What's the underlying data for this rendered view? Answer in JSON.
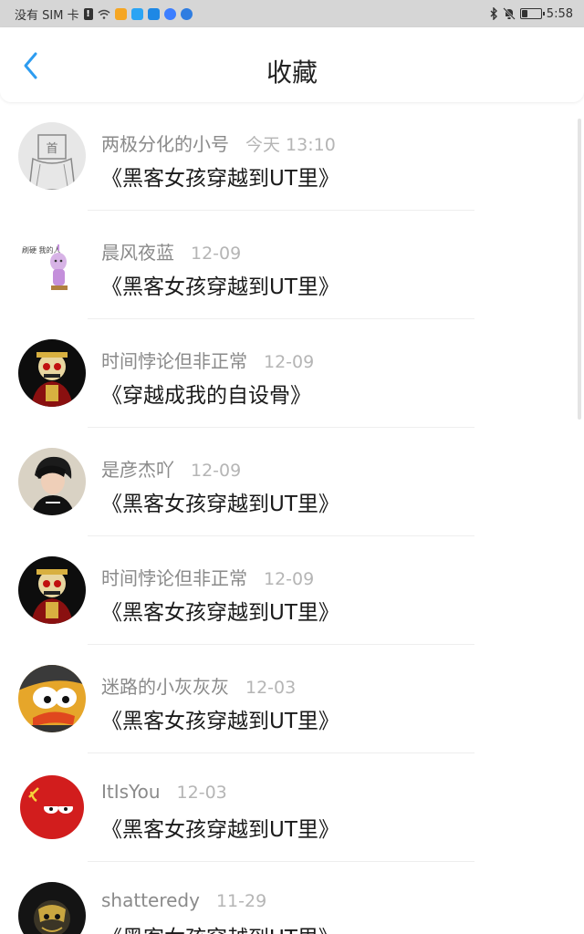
{
  "status_bar": {
    "carrier": "没有 SIM 卡",
    "sim_warning": "!",
    "time": "5:58",
    "battery_level": 0.3,
    "app_icons": [
      {
        "name": "game-app-icon",
        "color": "#f5a623"
      },
      {
        "name": "qq-app-icon",
        "color": "#2aa4f4"
      },
      {
        "name": "qq-alt-app-icon",
        "color": "#1e88e5"
      },
      {
        "name": "music-app-icon",
        "color": "#3d7eff"
      },
      {
        "name": "browser-app-icon",
        "color": "#2f7de1"
      }
    ]
  },
  "header": {
    "title": "收藏",
    "accent": "#2d9cf0"
  },
  "favorites": [
    {
      "username": "两极分化的小号",
      "date": "今天 13:10",
      "title": "《黑客女孩穿越到UT里》",
      "avatar": "sketch"
    },
    {
      "username": "晨风夜蓝",
      "date": "12-09",
      "title": "《黑客女孩穿越到UT里》",
      "avatar": "purple-figure"
    },
    {
      "username": "时间悖论但非正常",
      "date": "12-09",
      "title": "《穿越成我的自设骨》",
      "avatar": "skeleton-red"
    },
    {
      "username": "是彦杰吖",
      "date": "12-09",
      "title": "《黑客女孩穿越到UT里》",
      "avatar": "person-photo"
    },
    {
      "username": "时间悖论但非正常",
      "date": "12-09",
      "title": "《黑客女孩穿越到UT里》",
      "avatar": "skeleton-red"
    },
    {
      "username": "迷路的小灰灰灰",
      "date": "12-03",
      "title": "《黑客女孩穿越到UT里》",
      "avatar": "cartoon-yellow"
    },
    {
      "username": "ItIsYou",
      "date": "12-03",
      "title": "《黑客女孩穿越到UT里》",
      "avatar": "countryball-red"
    },
    {
      "username": "shatteredy",
      "date": "11-29",
      "title": "《黑客女孩穿越到UT里》",
      "avatar": "dark-gold"
    }
  ]
}
